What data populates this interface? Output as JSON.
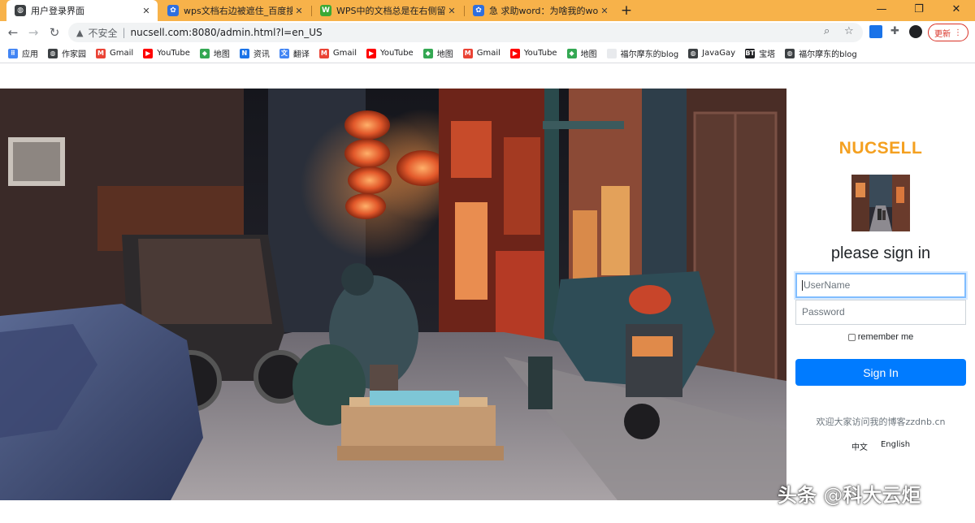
{
  "browser": {
    "tabs": [
      {
        "title": "用户登录界面",
        "active": true,
        "icon": "globe-icon"
      },
      {
        "title": "wps文档右边被遮住_百度搜索",
        "active": false,
        "icon": "baidu-paw-icon"
      },
      {
        "title": "WPS中的文档总是在右侧留下空白",
        "active": false,
        "icon": "wps-doc-icon"
      },
      {
        "title": "急 求助word：为啥我的word打",
        "active": false,
        "icon": "baidu-paw-icon"
      }
    ],
    "new_tab_glyph": "+",
    "window_controls": [
      "minimize-icon",
      "maximize-icon",
      "close-icon"
    ],
    "insecure_label": "不安全",
    "url": "nucsell.com:8080/admin.html?l=en_US",
    "update_label": "更新"
  },
  "bookmarks": [
    {
      "label": "应用",
      "icon": "apps-grid-icon"
    },
    {
      "label": "作家园",
      "icon": "globe-icon"
    },
    {
      "label": "Gmail",
      "icon": "gmail-icon"
    },
    {
      "label": "YouTube",
      "icon": "youtube-icon"
    },
    {
      "label": "地图",
      "icon": "maps-icon"
    },
    {
      "label": "资讯",
      "icon": "news-icon"
    },
    {
      "label": "翻译",
      "icon": "translate-icon"
    },
    {
      "label": "Gmail",
      "icon": "gmail-icon"
    },
    {
      "label": "YouTube",
      "icon": "youtube-icon"
    },
    {
      "label": "地图",
      "icon": "maps-icon"
    },
    {
      "label": "Gmail",
      "icon": "gmail-icon"
    },
    {
      "label": "YouTube",
      "icon": "youtube-icon"
    },
    {
      "label": "地图",
      "icon": "maps-icon"
    },
    {
      "label": "福尔摩东的blog",
      "icon": "blank-page-icon"
    },
    {
      "label": "JavaGay",
      "icon": "globe-icon"
    },
    {
      "label": "宝塔",
      "icon": "bt-icon"
    },
    {
      "label": "福尔摩东的blog",
      "icon": "globe-icon"
    }
  ],
  "login": {
    "brand": "NUCSELL",
    "title": "please sign in",
    "username_placeholder": "UserName",
    "password_placeholder": "Password",
    "remember_label": "remember me",
    "signin_label": "Sign In",
    "blog_note": "欢迎大家访问我的博客zzdnb.cn",
    "languages": [
      "中文",
      "English"
    ]
  },
  "watermark": {
    "brand": "头条",
    "at": "@",
    "author": "科大云炬"
  },
  "colors": {
    "tabstrip": "#f7b24a",
    "brand": "#f4a020",
    "primary_button": "#007bff",
    "focus_border": "#80bdff"
  }
}
